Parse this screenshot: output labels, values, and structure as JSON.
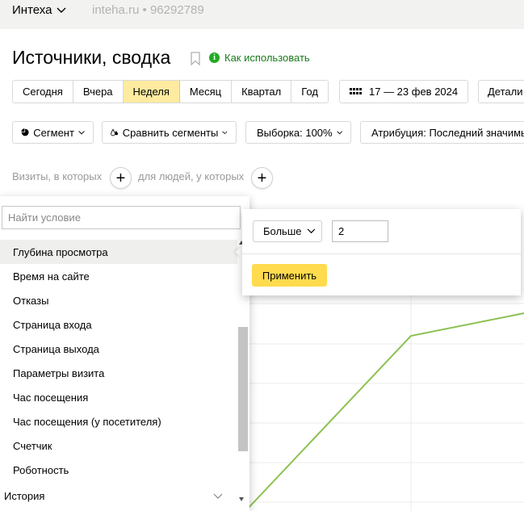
{
  "header": {
    "counter_name": "Интеха",
    "site_info": "inteha.ru • 96292789"
  },
  "page": {
    "title": "Источники, сводка",
    "howto_label": "Как использовать"
  },
  "periods": [
    {
      "label": "Сегодня",
      "active": false
    },
    {
      "label": "Вчера",
      "active": false
    },
    {
      "label": "Неделя",
      "active": true
    },
    {
      "label": "Месяц",
      "active": false
    },
    {
      "label": "Квартал",
      "active": false
    },
    {
      "label": "Год",
      "active": false
    }
  ],
  "date_range": "17 — 23 фев 2024",
  "detail_label": "Детали",
  "filters": {
    "segment": "Сегмент",
    "compare": "Сравнить сегменты",
    "sample": "Выборка: 100%",
    "attribution": "Атрибуция: Последний значимы"
  },
  "conditions": {
    "visits_label": "Визиты, в которых",
    "people_label": "для людей, у которых"
  },
  "dropdown": {
    "search_placeholder": "Найти условие",
    "items": [
      "Глубина просмотра",
      "Время на сайте",
      "Отказы",
      "Страница входа",
      "Страница выхода",
      "Параметры визита",
      "Час посещения",
      "Час посещения (у посетителя)",
      "Счетчик",
      "Роботность"
    ],
    "selected_index": 0,
    "history_label": "История"
  },
  "condition_panel": {
    "operator": "Больше",
    "value": "2",
    "apply_label": "Применить"
  },
  "colors": {
    "active_period": "#ffeba0",
    "apply_button": "#ffdb4d",
    "line": "#8cc152",
    "howto": "#1a7a1a"
  }
}
